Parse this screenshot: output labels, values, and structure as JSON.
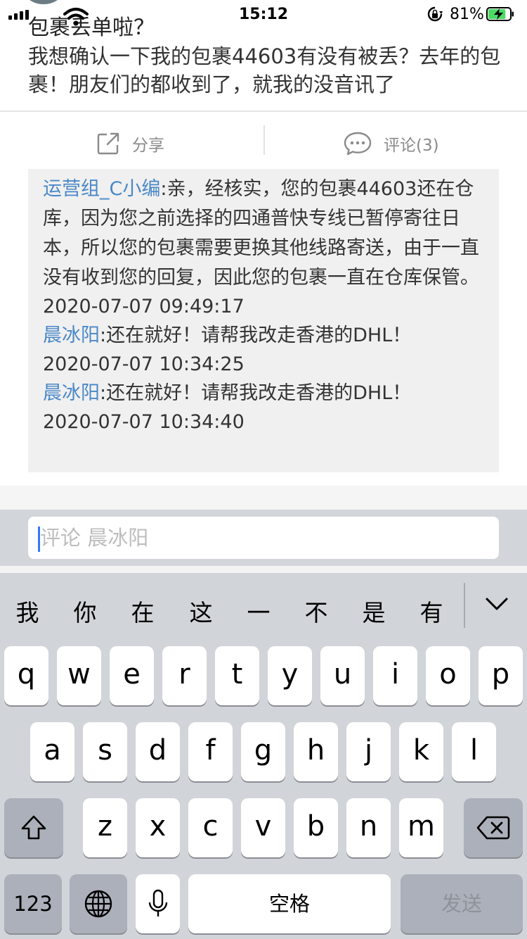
{
  "status_bar": {
    "time": "15:12",
    "battery_percent": "81%",
    "battery_level": 0.81,
    "icons": [
      "cellular-signal-icon",
      "wifi-icon",
      "orientation-lock-icon",
      "battery-charging-icon"
    ]
  },
  "post": {
    "title": "包裹丢单啦？",
    "body": "我想确认一下我的包裹44603有没有被丢？去年的包裹！朋友们的都收到了，就我的没音讯了"
  },
  "actions": {
    "share_label": "分享",
    "comment_label": "评论(3)"
  },
  "comments": [
    {
      "author": "运营组_C小编",
      "text": ":亲，经核实，您的包裹44603还在仓库，因为您之前选择的四通普快专线已暂停寄往日本，所以您的包裹需要更换其他线路寄送，由于一直没有收到您的回复，因此您的包裹一直在仓库保管。",
      "time": "2020-07-07 09:49:17"
    },
    {
      "author": "晨冰阳",
      "text": ":还在就好！请帮我改走香港的DHL！",
      "time": "2020-07-07 10:34:25"
    },
    {
      "author": "晨冰阳",
      "text": ":还在就好！请帮我改走香港的DHL！",
      "time": "2020-07-07 10:34:40"
    }
  ],
  "comment_input": {
    "placeholder": "评论 晨冰阳"
  },
  "keyboard": {
    "candidates": [
      "我",
      "你",
      "在",
      "这",
      "一",
      "不",
      "是",
      "有"
    ],
    "row1": [
      "q",
      "w",
      "e",
      "r",
      "t",
      "y",
      "u",
      "i",
      "o",
      "p"
    ],
    "row2": [
      "a",
      "s",
      "d",
      "f",
      "g",
      "h",
      "j",
      "k",
      "l"
    ],
    "row3": [
      "z",
      "x",
      "c",
      "v",
      "b",
      "n",
      "m"
    ],
    "numbers_label": "123",
    "space_label": "空格",
    "send_label": "发送"
  },
  "colors": {
    "author": "#4a88c7",
    "keyboard_bg": "#d1d4d9",
    "comment_bg": "#f0f0f0",
    "caret": "#3478f6"
  }
}
